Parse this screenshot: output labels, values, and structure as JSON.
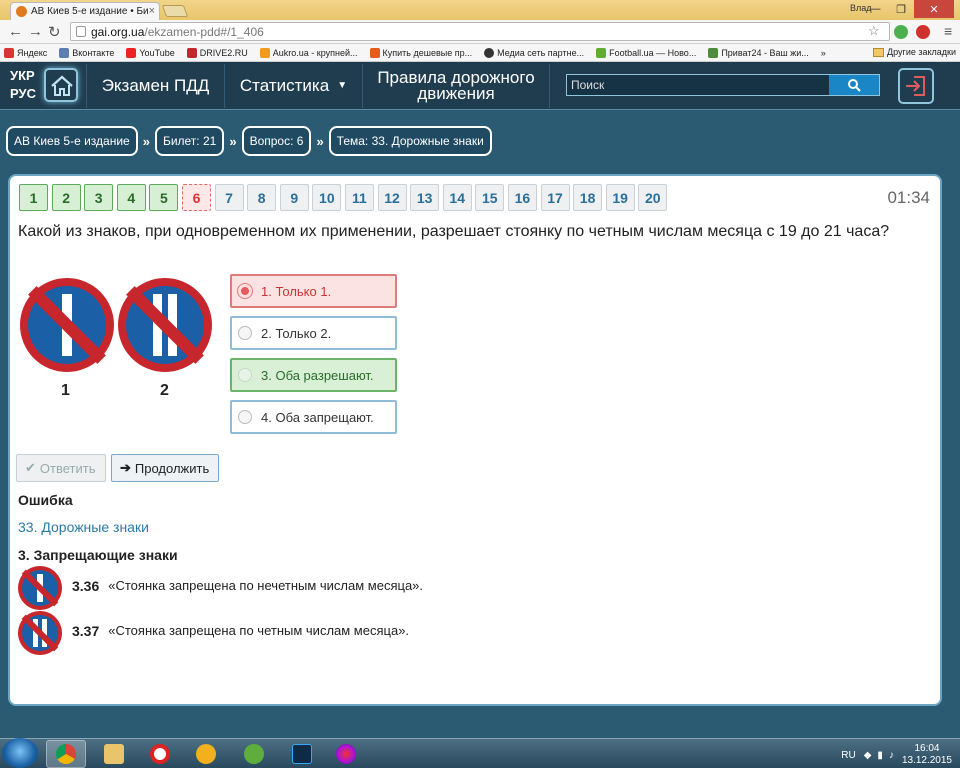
{
  "browser": {
    "tab_title": "АВ Киев 5-е издание • Би",
    "tab_close": "×",
    "user": "Влад",
    "url_host": "gai.org.ua",
    "url_path": "/ekzamen-pdd#/1_406",
    "bookmarks": [
      "Яндекс",
      "Вконтакте",
      "YouTube",
      "DRIVE2.RU",
      "Aukro.ua - крупней...",
      "Купить дешевые пр...",
      "Медиа сеть партне...",
      "Football.ua — Ново...",
      "Приват24 - Ваш жи..."
    ],
    "bookmark_more": "»",
    "other_bookmarks": "Другие закладки"
  },
  "header": {
    "lang_1": "УКР",
    "lang_2": "РУС",
    "nav_exam": "Экзамен ПДД",
    "nav_stats": "Статистика",
    "nav_rules_1": "Правила дорожного",
    "nav_rules_2": "движения",
    "search_placeholder": "Поиск"
  },
  "breadcrumbs": {
    "edition": "АВ Киев 5-е издание",
    "ticket": "Билет: 21",
    "question": "Вопрос: 6",
    "topic": "Тема: 33. Дорожные знаки",
    "separator": "»"
  },
  "exam": {
    "question_numbers": [
      "1",
      "2",
      "3",
      "4",
      "5",
      "6",
      "7",
      "8",
      "9",
      "10",
      "11",
      "12",
      "13",
      "14",
      "15",
      "16",
      "17",
      "18",
      "19",
      "20"
    ],
    "timer": "01:34",
    "question_text": "Какой из знаков, при одновременном их применении, разрешает стоянку по четным числам месяца с 19 до 21 часа?",
    "sign_labels": [
      "1",
      "2"
    ],
    "answers": [
      "1. Только 1.",
      "2. Только 2.",
      "3. Оба разрешают.",
      "4. Оба запрещают."
    ],
    "btn_answer": "Ответить",
    "btn_continue": "Продолжить",
    "result": "Ошибка",
    "topic_link": "33. Дорожные знаки",
    "section_title": "3. Запрещающие знаки",
    "rules": [
      {
        "code": "3.36",
        "text": "«Стоянка запрещена по нечетным числам месяца»."
      },
      {
        "code": "3.37",
        "text": "«Стоянка запрещена по четным числам месяца»."
      }
    ]
  },
  "taskbar": {
    "lang": "RU",
    "time": "16:04",
    "date": "13.12.2015"
  },
  "colors": {
    "page_bg": "#2b5a73",
    "header_bg": "#203d4f",
    "correct_green": "#5cab5b",
    "wrong_red": "#e06b6b",
    "link_blue": "#2a7aa8",
    "sign_red": "#c6262c",
    "sign_blue": "#1b5fa6"
  }
}
